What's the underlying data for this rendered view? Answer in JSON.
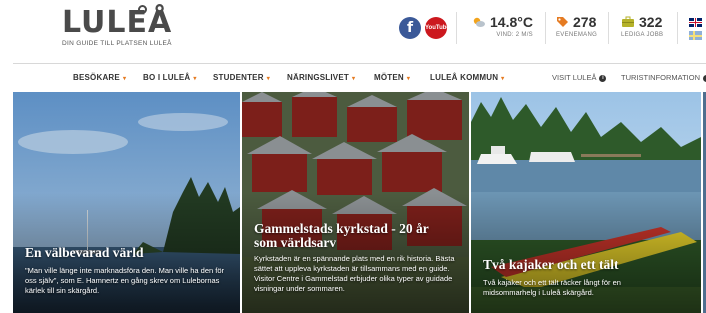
{
  "logo": {
    "wordmark": "LULEÅ",
    "tagline": "DIN GUIDE TILL PLATSEN LULEÅ"
  },
  "social": {
    "facebook_glyph": "f",
    "youtube_label": "YouTube"
  },
  "weather": {
    "value": "14.8°C",
    "label": "VIND: 2 M/S",
    "icon": "sun-cloud-icon"
  },
  "events": {
    "value": "278",
    "label": "EVENEMANG",
    "icon": "tag-icon"
  },
  "jobs": {
    "value": "322",
    "label": "LEDIGA JOBB",
    "icon": "briefcase-icon"
  },
  "nav": {
    "items": [
      {
        "label": "BESÖKARE"
      },
      {
        "label": "BO I LULEÅ"
      },
      {
        "label": "STUDENTER"
      },
      {
        "label": "NÄRINGSLIVET"
      },
      {
        "label": "MÖTEN"
      },
      {
        "label": "LULEÅ KOMMUN"
      }
    ],
    "caret": "▾",
    "visit": "VISIT LULEÅ",
    "tourist_info": "TURISTINFORMATION",
    "info_glyph": "i"
  },
  "cards": [
    {
      "title": "En välbevarad värld",
      "text": "\"Man ville länge inte marknadsföra den. Man ville ha den för oss själv\", som E. Hamnertz en gång skrev om Lulebornas kärlek till sin skärgård."
    },
    {
      "title": "Gammelstads kyrkstad - 20 år som världsarv",
      "text": "Kyrkstaden är en spännande plats med en rik historia. Bästa sättet att uppleva kyrkstaden är tillsammans med en guide. Visitor Centre i Gammelstad erbjuder olika typer av guidade visningar under sommaren."
    },
    {
      "title": "Två kajaker och ett tält",
      "text": "Två kajaker och ett tält räcker långt för en midsommarhelg i Luleå skärgård."
    }
  ],
  "colors": {
    "accent": "#e57b22",
    "facebook": "#3b5998",
    "youtube": "#cc181e"
  }
}
